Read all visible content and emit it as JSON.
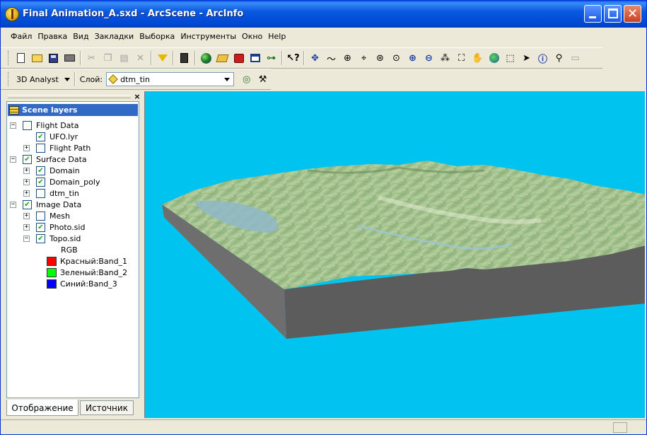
{
  "window": {
    "title": "Final Animation_A.sxd - ArcScene - ArcInfo"
  },
  "menu": [
    {
      "label": "Файл"
    },
    {
      "label": "Правка"
    },
    {
      "label": "Вид"
    },
    {
      "label": "Закладки"
    },
    {
      "label": "Выборка"
    },
    {
      "label": "Инструменты"
    },
    {
      "label": "Окно"
    },
    {
      "label": "Help"
    }
  ],
  "toolbar2": {
    "analyst_label": "3D Analyst",
    "layer_label": "Слой:",
    "layer_value": "dtm_tin"
  },
  "toc": {
    "root": "Scene layers",
    "rows": [
      {
        "label": "Flight Data",
        "checked": "false",
        "expander": "minus"
      },
      {
        "label": "UFO.lyr",
        "checked": "true",
        "expander": ""
      },
      {
        "label": "Flight Path",
        "checked": "false",
        "expander": "plus"
      },
      {
        "label": "Surface Data",
        "checked": "true",
        "expander": "minus"
      },
      {
        "label": "Domain",
        "checked": "true",
        "expander": "plus"
      },
      {
        "label": "Domain_poly",
        "checked": "true",
        "expander": "plus"
      },
      {
        "label": "dtm_tin",
        "checked": "false",
        "expander": "plus"
      },
      {
        "label": "Image Data",
        "checked": "true",
        "expander": "minus"
      },
      {
        "label": "Mesh",
        "checked": "false",
        "expander": "plus"
      },
      {
        "label": "Photo.sid",
        "checked": "true",
        "expander": "plus"
      },
      {
        "label": "Topo.sid",
        "checked": "true",
        "expander": "minus"
      }
    ],
    "legend_heading": "RGB",
    "legend": [
      {
        "label": "Красный:Band_1",
        "color": "#ff0000"
      },
      {
        "label": "Зеленый:Band_2",
        "color": "#00ff00"
      },
      {
        "label": "Синий:Band_3",
        "color": "#0000ff"
      }
    ],
    "tabs": {
      "display": "Отображение",
      "source": "Источник"
    }
  },
  "colors": {
    "scene_background": "#00c3f0",
    "selection": "#316ac5",
    "terrain_side": "#5a5a5a"
  },
  "icons": {
    "toolbar1": [
      "new-document-icon",
      "open-folder-icon",
      "save-icon",
      "print-icon",
      "cut-icon",
      "copy-icon",
      "paste-icon",
      "delete-icon",
      "add-data-icon",
      "calculator-icon",
      "globe-icon",
      "layers-icon",
      "arc-toolbox-icon",
      "window-icon",
      "model-builder-icon",
      "whats-this-icon",
      "navigate-icon",
      "fly-icon",
      "zoom-in-out-icon",
      "target-center-icon",
      "zoom-to-target-icon",
      "set-observer-icon",
      "zoom-in-icon",
      "zoom-out-icon",
      "fixed-zoom-in-icon",
      "fixed-zoom-out-icon",
      "pan-icon",
      "full-extent-icon",
      "select-features-icon",
      "select-pointer-icon",
      "identify-icon",
      "find-icon",
      "html-popup-icon"
    ]
  }
}
